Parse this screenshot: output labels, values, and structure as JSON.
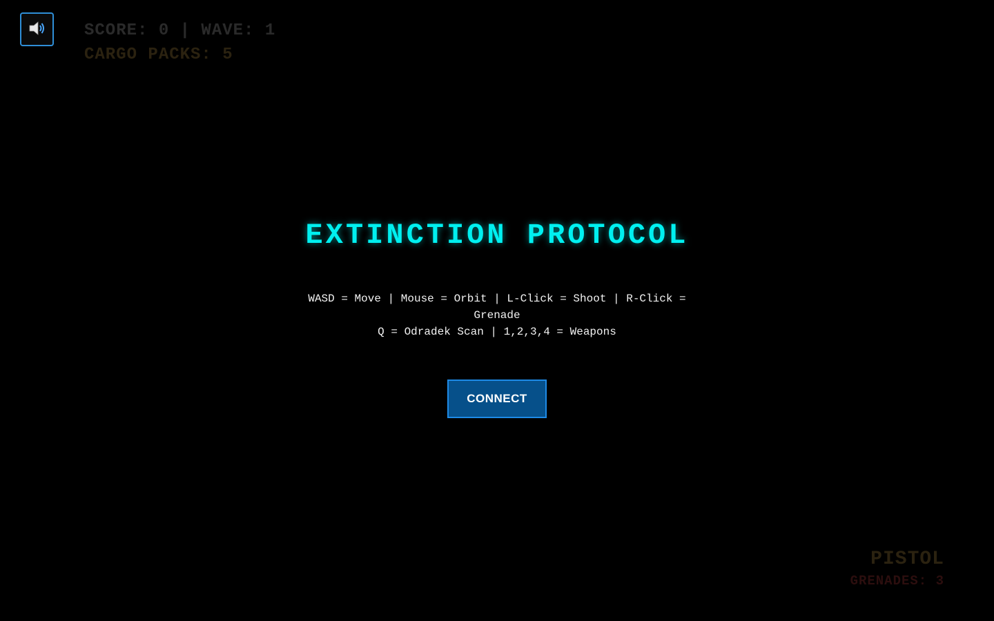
{
  "hud": {
    "score_line": "SCORE: 0 | WAVE: 1",
    "cargo_line": "CARGO PACKS: 5",
    "weapon": "PISTOL",
    "grenades": "GRENADES: 3"
  },
  "sound_button": {
    "icon": "speaker-icon"
  },
  "menu": {
    "title": "EXTINCTION PROTOCOL",
    "controls_line1": "WASD = Move | Mouse = Orbit | L-Click = Shoot | R-Click = Grenade",
    "controls_line2": "Q = Odradek Scan | 1,2,3,4 = Weapons",
    "connect_label": "CONNECT"
  },
  "colors": {
    "accent_cyan": "#00f0f0",
    "button_fill": "#06508a",
    "button_border": "#1e8ae6",
    "background": "#000000"
  }
}
